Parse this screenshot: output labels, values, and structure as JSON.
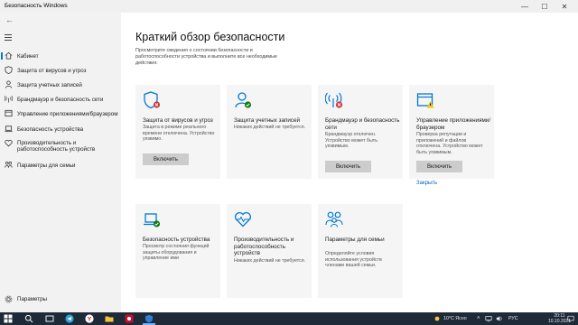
{
  "window": {
    "title": "Безопасность Windows",
    "controls": [
      "—",
      "☐",
      "✕"
    ]
  },
  "sidebar": {
    "items": [
      {
        "label": "Кабинет",
        "icon": "home-icon",
        "active": true
      },
      {
        "label": "Защита от вирусов и угроз",
        "icon": "shield-icon"
      },
      {
        "label": "Защита учетных записей",
        "icon": "person-icon"
      },
      {
        "label": "Брандмауэр и безопасность сети",
        "icon": "wifi-icon"
      },
      {
        "label": "Управление приложениями/браузером",
        "icon": "app-browser-icon"
      },
      {
        "label": "Безопасность устройства",
        "icon": "laptop-icon"
      },
      {
        "label": "Производительность и работоспособность устройств",
        "icon": "heart-icon"
      },
      {
        "label": "Параметры для семьи",
        "icon": "family-icon"
      }
    ],
    "settings_label": "Параметры"
  },
  "main": {
    "title": "Краткий обзор безопасности",
    "subtitle": "Просмотрите сведения о состоянии безопасности и работоспособности устройства и выполните все необходимые действия.",
    "tiles": [
      {
        "name": "Защита от вирусов и угроз",
        "desc": "Защита в режиме реального времени отключена. Устройство уязвимо.",
        "button": "Включить",
        "status": "error",
        "icon": "shield-icon"
      },
      {
        "name": "Защита учетных записей",
        "desc": "Никаких действий не требуется.",
        "status": "ok",
        "icon": "person-icon"
      },
      {
        "name": "Брандмауэр и безопасность сети",
        "desc": "Брандмауэр отключен. Устройство может быть уязвимым.",
        "button": "Включить",
        "status": "error",
        "icon": "wifi-icon"
      },
      {
        "name": "Управление приложениями/браузером",
        "desc": "Проверка репутации и приложений и файлов отключена. Устройство может быть уязвимым.",
        "button": "Включить",
        "link": "Закрыть",
        "status": "warning",
        "icon": "app-browser-icon"
      },
      {
        "name": "Безопасность устройства",
        "desc": "Просмотр состояния функций защиты оборудования и управление ими",
        "status": "ok",
        "icon": "laptop-icon"
      },
      {
        "name": "Производительность и работоспособность устройств",
        "desc": "Никаких действий не требуется.",
        "icon": "heart-icon"
      },
      {
        "name": "Параметры для семьи",
        "desc": "Определяйте условия использования устройств членами вашей семьи.",
        "icon": "family-icon"
      }
    ]
  },
  "taskbar": {
    "weather": "10°C Ясно",
    "lang": "РУС",
    "time": "20:11",
    "date": "10.10.2021"
  },
  "colors": {
    "accent": "#0078d4",
    "error": "#d13438",
    "ok": "#107c10",
    "warning": "#f2c811",
    "link": "#0067c0"
  }
}
